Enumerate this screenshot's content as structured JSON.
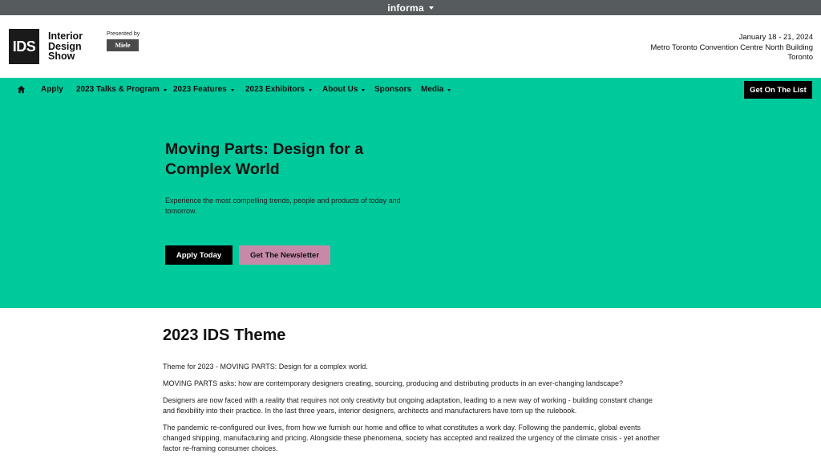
{
  "topbar": {
    "brand": "informa"
  },
  "header": {
    "logo": {
      "mark": "IDS",
      "line1": "Interior",
      "line2": "Design",
      "line3": "Show"
    },
    "presented_by": "Presented by",
    "sponsor": "Miele",
    "event": {
      "dates": "January 18 - 21, 2024",
      "venue": "Metro Toronto Convention Centre North Building",
      "city": "Toronto"
    }
  },
  "nav": {
    "home_icon": "home-icon",
    "items": [
      {
        "label": "Apply",
        "dropdown": false
      },
      {
        "label": "2023 Talks & Program",
        "dropdown": true
      },
      {
        "label": "2023 Features",
        "dropdown": true
      },
      {
        "label": "2023 Exhibitors",
        "dropdown": true
      },
      {
        "label": "About Us",
        "dropdown": true
      },
      {
        "label": "Sponsors",
        "dropdown": false
      },
      {
        "label": "Media",
        "dropdown": true
      }
    ],
    "cta": "Get On The List"
  },
  "hero": {
    "title": "Moving Parts: Design for a Complex World",
    "subtitle": "Experience the most compelling trends, people and products of today and tomorrow.",
    "primary_button": "Apply Today",
    "secondary_button": "Get The Newsletter"
  },
  "content": {
    "heading": "2023 IDS Theme",
    "paragraphs": [
      "Theme for 2023 - MOVING PARTS: Design for a complex world.",
      "MOVING PARTS asks: how are contemporary designers creating, sourcing, producing and distributing products in an ever-changing landscape?",
      "Designers are now faced with a reality that requires not only creativity but ongoing adaptation, leading to a new way of working - building constant change and flexibility into their practice.  In the last three years, interior designers, architects and manufacturers have torn up the rulebook.",
      "The pandemic re-configured our lives, from how we furnish our home and office to what constitutes a work day. Following the pandemic, global events changed shipping, manufacturing and pricing. Alongside these phenomena, society has accepted and realized the urgency of the climate crisis - yet another factor re-framing consumer choices."
    ]
  },
  "colors": {
    "accent_green": "#00c99c",
    "newsletter_pink": "#c68aa8",
    "topbar_gray": "#565b5e"
  }
}
